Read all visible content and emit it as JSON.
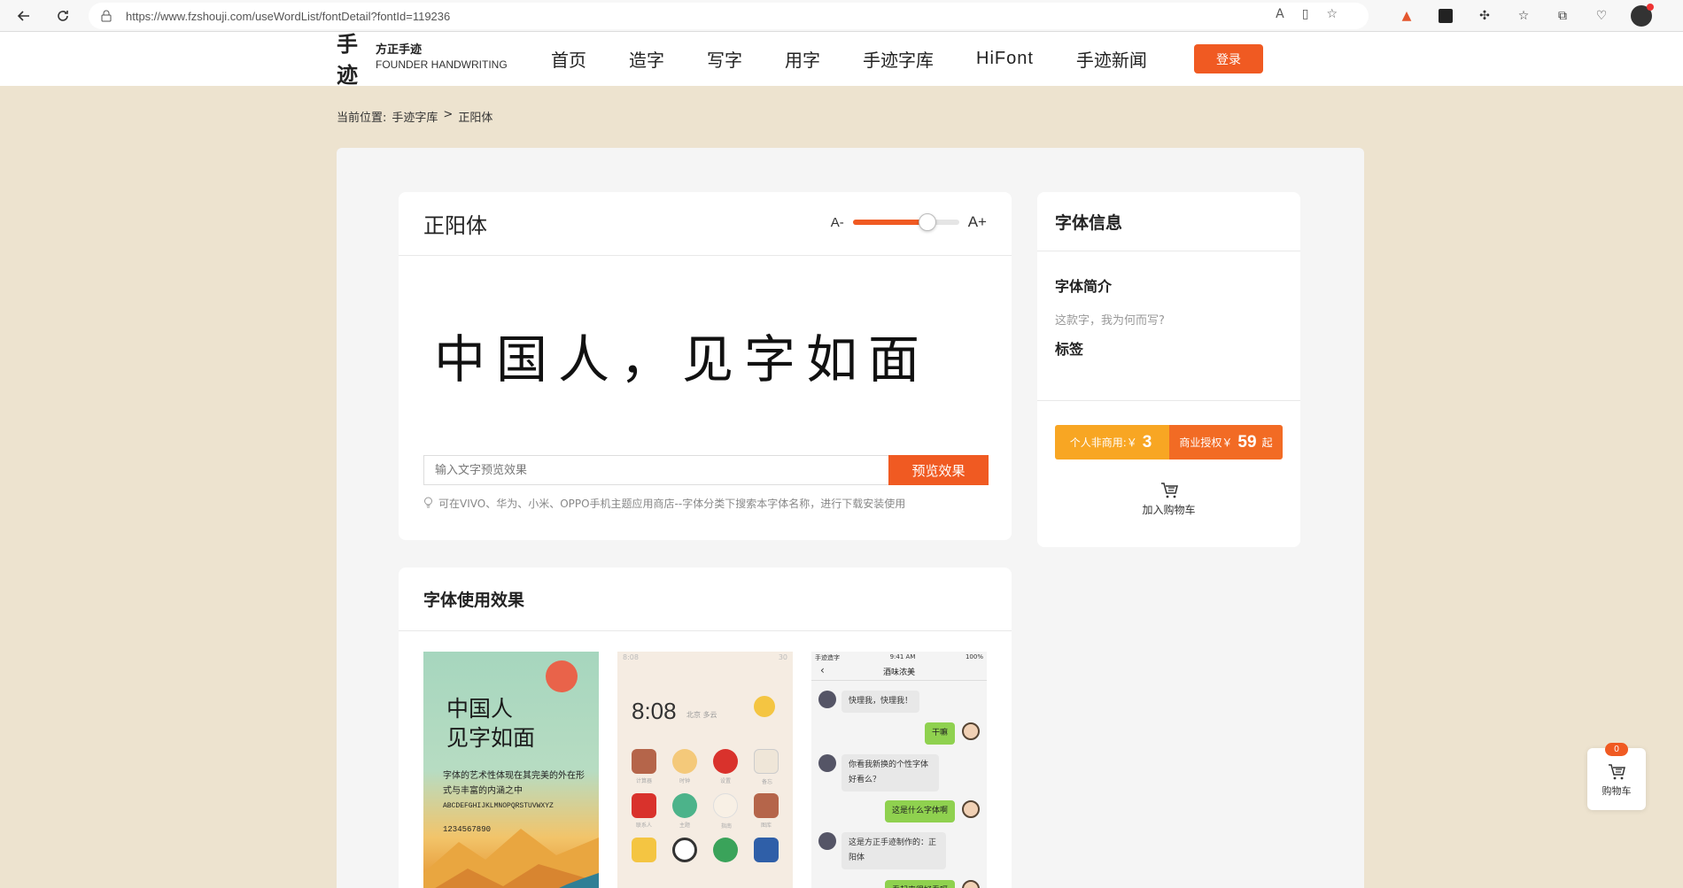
{
  "browser": {
    "url": "https://www.fzshouji.com/useWordList/fontDetail?fontId=119236"
  },
  "header": {
    "logo_mark": "手迹",
    "logo_cn": "方正手迹",
    "logo_en": "FOUNDER HANDWRITING",
    "nav": [
      "首页",
      "造字",
      "写字",
      "用字",
      "手迹字库",
      "HiFont",
      "手迹新闻"
    ],
    "login_label": "登录"
  },
  "breadcrumb": {
    "prefix": "当前位置:",
    "parent": "手迹字库",
    "separator": ">",
    "current": "正阳体"
  },
  "preview": {
    "font_name": "正阳体",
    "size_small_label": "A-",
    "size_large_label": "A+",
    "size_slider_fraction": 0.7,
    "sample_text": "中国人，见字如面",
    "input_placeholder": "输入文字预览效果",
    "preview_button": "预览效果",
    "hint": "可在VIVO、华为、小米、OPPO手机主题应用商店--字体分类下搜索本字体名称，进行下载安装使用"
  },
  "info": {
    "heading": "字体信息",
    "intro_title": "字体简介",
    "intro_text": "这款字，我为何而写?",
    "tags_title": "标签",
    "personal_label": "个人非商用:￥",
    "personal_price": "3",
    "business_label": "商业授权￥",
    "business_price": "59",
    "business_suffix": "起",
    "add_cart": "加入购物车"
  },
  "effects": {
    "heading": "字体使用效果",
    "poster": {
      "big_line1": "中国人",
      "big_line2": "见字如面",
      "small_text": "字体的艺术性体现在其完美的外在形式与丰富的内涵之中",
      "alphabet": "ABCDEFGHIJKLMNOPQRSTUVWXYZ",
      "numbers": "1234567890"
    },
    "phone": {
      "status_left": "8:08",
      "status_right": "30",
      "clock": "8:08",
      "clock_sub": "北京 多云",
      "apps": [
        "计算器",
        "时钟",
        "设置",
        "备忘",
        "联系人",
        "主题",
        "指南",
        "图库",
        "",
        "",
        "",
        ""
      ]
    },
    "chat": {
      "status_left": "手迹造字",
      "status_time": "9:41 AM",
      "status_right": "100%",
      "title": "酒味浓美",
      "msg1": "快理我，快理我！",
      "reply1": "干嘛",
      "msg2": "你看我新换的个性字体好看么？",
      "reply2": "这是什么字体啊",
      "msg3": "这是方正手迹制作的：正阳体",
      "reply3": "看起来很好看呀"
    }
  },
  "floating_cart": {
    "count": "0",
    "label": "购物车"
  },
  "colors": {
    "accent": "#f05a22",
    "personal_price_bg": "#f8a623",
    "page_bg": "#ede3cf"
  }
}
